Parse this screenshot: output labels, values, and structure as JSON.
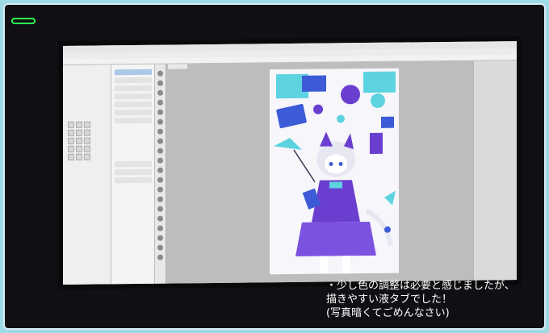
{
  "caption": {
    "line1": "・少し色の調整は必要と感じましたが、",
    "line2": "描きやすい液タブでした！",
    "line3": "(写真暗くてごめんなさい)"
  },
  "colors": {
    "background_outer": "#9fd9e6",
    "frame_border": "#d7eef3",
    "photo_dark": "#101014",
    "indicator_green": "#2cff4f",
    "app_gray": "#cfcfcf",
    "art_cyan": "#5ed3e0",
    "art_purple": "#6a3fd0",
    "art_blue": "#3d5bd6"
  },
  "icons": [
    "brush-icon",
    "pen-icon",
    "eraser-icon",
    "fill-icon",
    "select-icon",
    "hand-icon"
  ]
}
